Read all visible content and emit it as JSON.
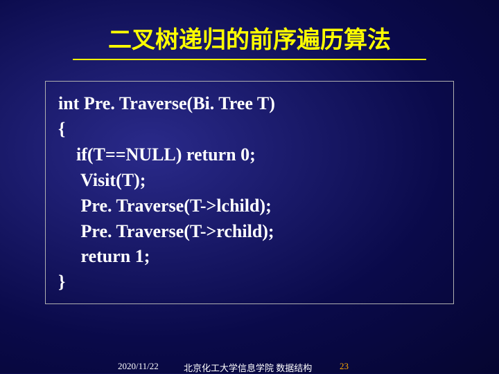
{
  "title": "二叉树递归的前序遍历算法",
  "code": {
    "line1": "int Pre. Traverse(Bi. Tree T)",
    "line2": "{",
    "line3": "    if(T==NULL) return 0;",
    "line4": "     Visit(T);",
    "line5": "     Pre. Traverse(T->lchild);",
    "line6": "     Pre. Traverse(T->rchild);",
    "line7": "     return 1;",
    "line8": "}"
  },
  "footer": {
    "date": "2020/11/22",
    "center": "北京化工大学信息学院  数据结构",
    "page": "23"
  }
}
